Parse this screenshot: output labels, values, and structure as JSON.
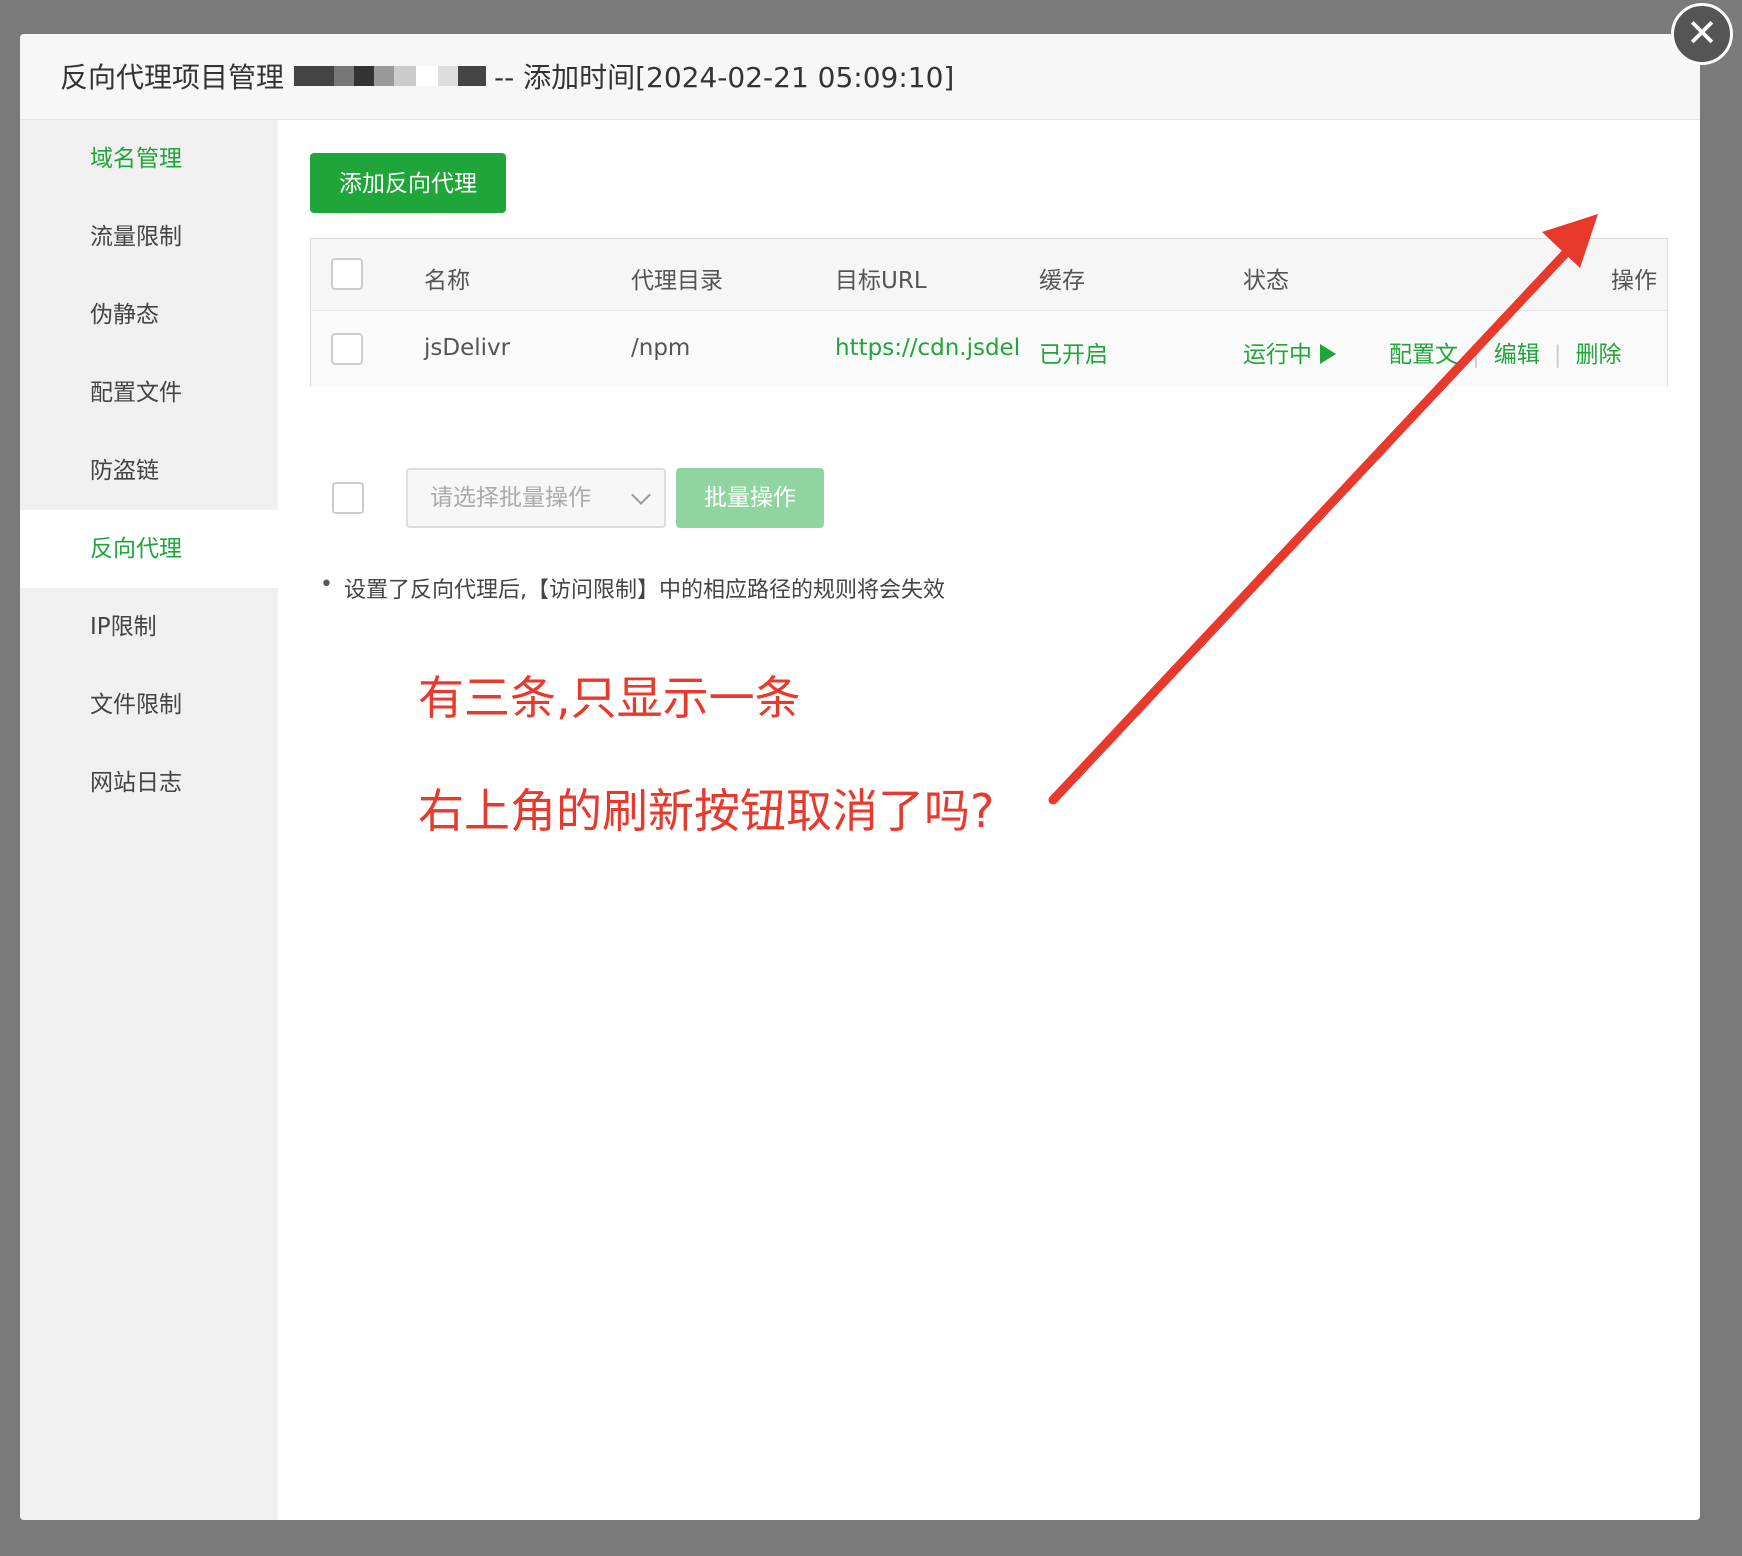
{
  "dialog": {
    "title_prefix": "反向代理项目管理",
    "title_suffix": "-- 添加时间[2024-02-21 05:09:10]",
    "close_glyph": "✕"
  },
  "sidebar": {
    "items": [
      {
        "label": "域名管理"
      },
      {
        "label": "流量限制"
      },
      {
        "label": "伪静态"
      },
      {
        "label": "配置文件"
      },
      {
        "label": "防盗链"
      },
      {
        "label": "反向代理"
      },
      {
        "label": "IP限制"
      },
      {
        "label": "文件限制"
      },
      {
        "label": "网站日志"
      }
    ],
    "active_index": 5
  },
  "main": {
    "add_button_label": "添加反向代理",
    "table": {
      "headers": {
        "name": "名称",
        "dir": "代理目录",
        "url": "目标URL",
        "cache": "缓存",
        "status": "状态",
        "ops": "操作"
      },
      "rows": [
        {
          "name": "jsDelivr",
          "dir": "/npm",
          "url": "https://cdn.jsdel",
          "cache": "已开启",
          "status": "运行中",
          "op_config": "配置文",
          "op_edit": "编辑",
          "op_delete": "删除"
        }
      ]
    },
    "batch": {
      "select_placeholder": "请选择批量操作",
      "button_label": "批量操作"
    },
    "note": "设置了反向代理后,【访问限制】中的相应路径的规则将会失效"
  },
  "annotation": {
    "line1": "有三条,只显示一条",
    "line2": "右上角的刷新按钮取消了吗?",
    "color": "#e8392c"
  },
  "colors": {
    "accent": "#20a53a",
    "overlay": "#7a7a7a"
  }
}
